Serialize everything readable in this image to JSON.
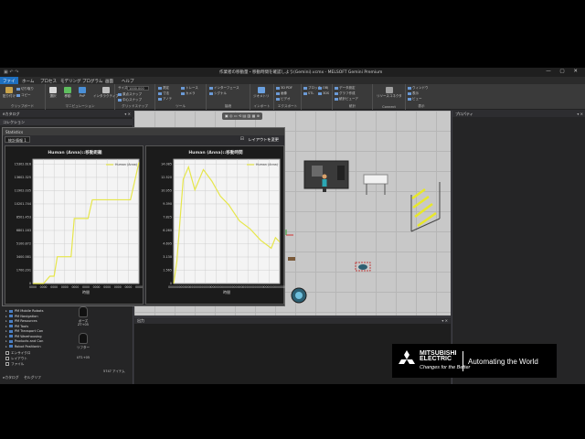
{
  "window": {
    "title": "作業者の移動量・移動時間を確認しよう(Gemini).vcmx - MELSOFT Gemini Premium",
    "controls": "— ▢ ✕"
  },
  "menu": [
    "ファイル",
    "ホーム",
    "プロセス",
    "モデリング",
    "プログラム",
    "画面",
    "ヘルプ"
  ],
  "ribbon": {
    "groups": [
      {
        "label": "クリップボード",
        "buttons": [
          "貼り付け"
        ],
        "small": [
          "切り取り",
          "コピー"
        ]
      },
      {
        "label": "マニピュレーション",
        "buttons": [
          "選択",
          "移動",
          "PnP",
          "インタラクティブ"
        ]
      },
      {
        "label": "グリッドスナップ",
        "small": [
          "サイズ",
          "原点スナップ",
          "中心スナップ"
        ],
        "size_value": "1000.000"
      },
      {
        "label": "ツール",
        "small": [
          "測定",
          "寸法",
          "アノテ",
          "トレース",
          "カメラ"
        ]
      },
      {
        "label": "接続",
        "small": [
          "インターフェース",
          "シグナル"
        ]
      },
      {
        "label": "インポート",
        "buttons": [
          "ジオメトリ"
        ]
      },
      {
        "label": "エクスポート",
        "small": [
          "3D PDF",
          "画像",
          "ビデオ"
        ]
      },
      {
        "label": "",
        "small": [
          "ブロック",
          "STL",
          "OBJ",
          "3DS"
        ]
      },
      {
        "label": "統計",
        "small": [
          "データ設定",
          "グラフ作成",
          "統計ビューア"
        ]
      },
      {
        "label": "Connect",
        "buttons": [
          "リソースコネクタ"
        ]
      },
      {
        "label": "表示",
        "small": [
          "ウィンドウ",
          "表示",
          "ビュー"
        ]
      }
    ]
  },
  "left_panel": {
    "title": "eカタログ",
    "subheader": "コレクション",
    "tree": [
      "PM Mobile Robots",
      "PM Navigation",
      "PM Resources",
      "PM Tools",
      "PM Transport Con",
      "PM Warehousing",
      "Products and Con",
      "Robot Positionin"
    ],
    "avatars": [
      {
        "label": "ポーズ"
      },
      {
        "label": "ZT+05"
      },
      {
        "label": "リフター"
      },
      {
        "label": "UT1+05"
      }
    ],
    "filters": [
      "エンサイクロ",
      "レイアウト",
      "ファイル"
    ],
    "bottom_tabs": [
      "eカタログ",
      "セルグリフ"
    ],
    "count_label": "5747 アイテム"
  },
  "stats_window": {
    "title": "Statistics",
    "tab": "統計情報 1",
    "layout_button": "レイアウトを変更"
  },
  "properties": {
    "title": "プロパティ"
  },
  "output": {
    "title": "出力"
  },
  "chart_data": [
    {
      "type": "line",
      "title": "Human (Anna)::移動距離",
      "xlabel": "時間",
      "series": [
        {
          "name": "Human (Anna)",
          "color": "#e6e64a",
          "x": [
            0,
            1,
            1.6,
            2,
            2.3,
            3.6,
            3.9,
            4.5,
            5.2,
            5.6,
            6.4,
            7,
            8.2,
            9.2,
            10
          ],
          "y": [
            0,
            0,
            900,
            900,
            3300,
            3300,
            8000,
            8000,
            8000,
            10300,
            10300,
            10300,
            10300,
            10300,
            14900
          ]
        }
      ],
      "y_ticks": [
        "0",
        "1700.291",
        "3400.581",
        "5100.872",
        "6801.163",
        "8501.453",
        "10201.744",
        "11902.035",
        "13602.325",
        "15302.616"
      ],
      "x_ticks": [
        "0000",
        "0000",
        "0000",
        "0000",
        "0000",
        "0000",
        "0000",
        "0000",
        "0000",
        "0000",
        "0000"
      ],
      "ylim": [
        0,
        15302.616
      ]
    },
    {
      "type": "line",
      "title": "Human (Anna)::移動時間",
      "xlabel": "時間",
      "series": [
        {
          "name": "Human (Anna)",
          "color": "#e6e64a",
          "x": [
            0,
            0.3,
            0.9,
            1.4,
            2.0,
            2.8,
            3.6,
            4.4,
            5.2,
            6.2,
            7.2,
            8.2,
            9.2,
            9.6,
            10
          ],
          "y": [
            0,
            2.5,
            11.8,
            13.2,
            10.6,
            12.9,
            11.6,
            9.9,
            8.9,
            7.1,
            6.2,
            4.9,
            4.0,
            5.2,
            4.7
          ]
        }
      ],
      "y_ticks": [
        "0",
        "1.565",
        "3.130",
        "4.695",
        "6.260",
        "7.825",
        "9.390",
        "10.955",
        "12.520",
        "14.085"
      ],
      "x_ticks": [
        "000000",
        "000000",
        "000000",
        "000000",
        "000000",
        "000000",
        "000000",
        "000000",
        "000000",
        "000000",
        "000000"
      ],
      "ylim": [
        0,
        14.085
      ]
    }
  ],
  "logo": {
    "brand_line1": "MITSUBISHI",
    "brand_line2": "ELECTRIC",
    "slogan": "Changes for the Better",
    "tagline": "Automating the World"
  },
  "colors": {
    "accent": "#1e6fbf",
    "series": "#e6e64a",
    "highlight": "#e8e82a"
  }
}
